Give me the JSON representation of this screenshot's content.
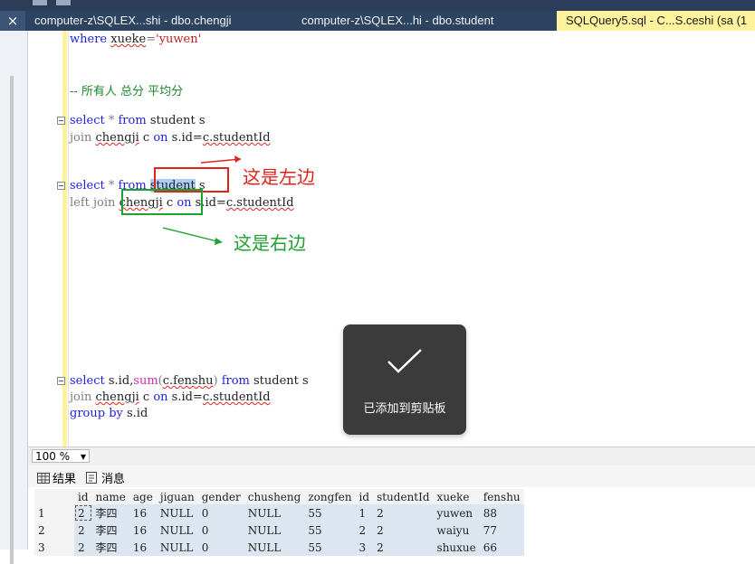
{
  "tabs": [
    {
      "label": "computer-z\\SQLEX...shi - dbo.chengji",
      "active": false
    },
    {
      "label": "computer-z\\SQLEX...hi - dbo.student",
      "active": false
    },
    {
      "label": "SQLQuery5.sql - C...S.ceshi (sa (1",
      "active": true
    }
  ],
  "close_glyph": "×",
  "editor": {
    "line1": {
      "kw": "where",
      "col": "xueke",
      "op": "=",
      "val": "'yuwen'"
    },
    "comment": "-- 所有人 总分 平均分",
    "q1": {
      "select": "select",
      "star": " * ",
      "from": "from",
      "rest": " student s",
      "join": "join",
      "t2": "chengji",
      "alias": " c ",
      "on": "on",
      "cond1": " s.id=",
      "cond2": "c.studentId"
    },
    "q2": {
      "select": "select",
      "star": " * ",
      "from": "from",
      "table": "student",
      "rest": " s",
      "left": "left join",
      "t2": "chengji",
      "alias": " c ",
      "on": "on",
      "cond1": " s.id=",
      "cond2": "c.studentId"
    },
    "q3": {
      "select": "select",
      "cols": " s.id,",
      "fn": "sum",
      "arg": "c.fenshu",
      "from": "from",
      "rest": " student s",
      "join": "join",
      "t2": "chengji",
      "alias": " c ",
      "on": "on",
      "cond1": " s.id=",
      "cond2": "c.studentId",
      "group": "group by",
      "grest": " s.id"
    }
  },
  "annotations": {
    "left": "这是左边",
    "right": "这是右边",
    "left_color": "#e0241b",
    "right_color": "#1fa12f"
  },
  "toast": {
    "message": "已添加到剪贴板",
    "icon": "checkmark-icon"
  },
  "zoom": "100 %",
  "result_tabs": {
    "results": "结果",
    "messages": "消息"
  },
  "grid": {
    "columns": [
      "id",
      "name",
      "age",
      "jiguan",
      "gender",
      "chusheng",
      "zongfen",
      "id",
      "studentId",
      "xueke",
      "fenshu"
    ],
    "rows": [
      [
        "1",
        "2",
        "李四",
        "16",
        "NULL",
        "0",
        "NULL",
        "55",
        "1",
        "2",
        "yuwen",
        "88"
      ],
      [
        "2",
        "2",
        "李四",
        "16",
        "NULL",
        "0",
        "NULL",
        "55",
        "2",
        "2",
        "waiyu",
        "77"
      ],
      [
        "3",
        "2",
        "李四",
        "16",
        "NULL",
        "0",
        "NULL",
        "55",
        "3",
        "2",
        "shuxue",
        "66"
      ]
    ]
  }
}
